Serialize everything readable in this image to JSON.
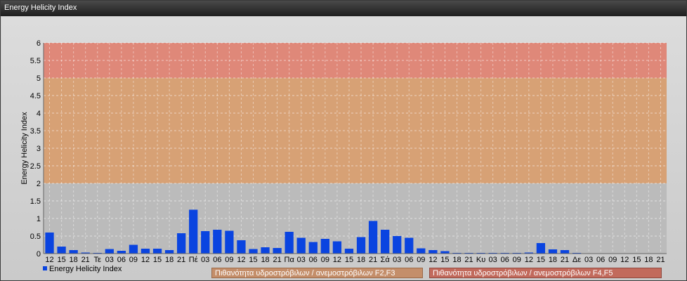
{
  "window": {
    "title": "Energy Helicity Index"
  },
  "legend": {
    "series_label": "Energy Helicity Index"
  },
  "bands_legend": {
    "mid": "Πιθανότητα υδροστρόβιλων / ανεμοστρόβιλων F2,F3",
    "high": "Πιθανότητα υδροστρόβιλων / ανεμοστρόβιλων F4,F5"
  },
  "colors": {
    "bar": "#0a44e0",
    "band_low": "#b9b9b9",
    "band_mid": "#d79e70",
    "band_high": "#df8474"
  },
  "chart_data": {
    "type": "bar",
    "ylabel": "Energy Helicity Index",
    "ylim": [
      0,
      6
    ],
    "yticks": [
      "0",
      "0.5",
      "1",
      "1.5",
      "2",
      "2.5",
      "3",
      "3.5",
      "4",
      "4.5",
      "5",
      "5.5",
      "6"
    ],
    "bands": [
      {
        "from": 0,
        "to": 2,
        "color": "#b9b9b9"
      },
      {
        "from": 2,
        "to": 5,
        "color": "#d79e70"
      },
      {
        "from": 5,
        "to": 6,
        "color": "#df8474"
      }
    ],
    "grid": true,
    "legend_position": "bottom",
    "categories": [
      "12",
      "15",
      "18",
      "21",
      "Τε",
      "03",
      "06",
      "09",
      "12",
      "15",
      "18",
      "21",
      "Πέ",
      "03",
      "06",
      "09",
      "12",
      "15",
      "18",
      "21",
      "Πα",
      "03",
      "06",
      "09",
      "12",
      "15",
      "18",
      "21",
      "Σά",
      "03",
      "06",
      "09",
      "12",
      "15",
      "18",
      "21",
      "Κυ",
      "03",
      "06",
      "09",
      "12",
      "15",
      "18",
      "21",
      "Δε",
      "03",
      "06",
      "09",
      "12",
      "15",
      "18",
      "21"
    ],
    "series": [
      {
        "name": "Energy Helicity Index",
        "values": [
          0.6,
          0.2,
          0.1,
          0.03,
          0.02,
          0.13,
          0.08,
          0.25,
          0.14,
          0.14,
          0.1,
          0.58,
          1.25,
          0.64,
          0.68,
          0.65,
          0.38,
          0.13,
          0.18,
          0.16,
          0.62,
          0.45,
          0.33,
          0.42,
          0.35,
          0.14,
          0.47,
          0.93,
          0.68,
          0.5,
          0.45,
          0.15,
          0.1,
          0.07,
          0.02,
          0.02,
          0.02,
          0.02,
          0.02,
          0.02,
          0.03,
          0.3,
          0.12,
          0.1,
          0.02,
          0.01,
          0.01,
          0.01,
          0.01,
          0.01,
          0.01,
          0.01,
          0.01
        ]
      }
    ]
  }
}
